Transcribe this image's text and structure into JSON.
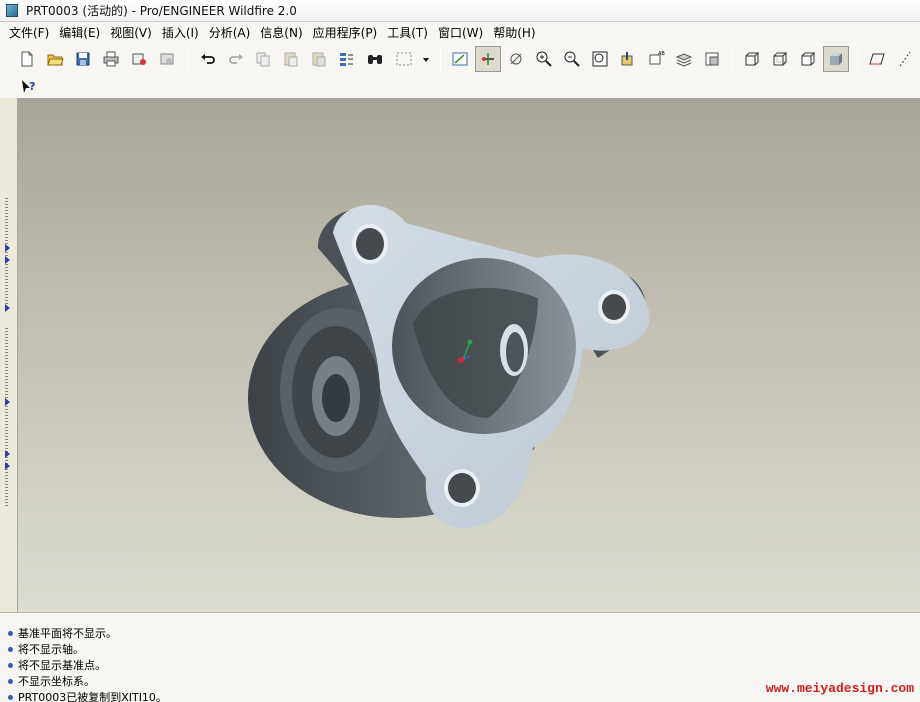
{
  "window": {
    "title": "PRT0003 (活动的) - Pro/ENGINEER Wildfire 2.0"
  },
  "menu": [
    "文件(F)",
    "编辑(E)",
    "视图(V)",
    "插入(I)",
    "分析(A)",
    "信息(N)",
    "应用程序(P)",
    "工具(T)",
    "窗口(W)",
    "帮助(H)"
  ],
  "toolbar": {
    "icons": [
      "new-icon",
      "open-icon",
      "save-icon",
      "print-icon",
      "send-icon",
      "close-window-icon",
      "undo-icon",
      "redo-icon",
      "copy-icon",
      "paste-icon",
      "paste-special-icon",
      "regenerate-icon",
      "find-icon",
      "selection-box-icon",
      "dropdown-icon",
      "datum-plane-icon",
      "datum-axis-icon",
      "datum-point-icon",
      "zoom-in-icon",
      "zoom-out-icon",
      "refit-icon",
      "reorient-icon",
      "saved-views-icon",
      "layers-icon",
      "view-manager-icon",
      "wireframe-icon",
      "hidden-line-icon",
      "no-hidden-icon",
      "shading-icon",
      "datum-plane-display-icon",
      "datum-axis-display-icon"
    ]
  },
  "context_help": "context-help-icon",
  "messages": [
    "基准平面将不显示。",
    "将不显示轴。",
    "将不显示基准点。",
    "不显示坐标系。",
    "PRT0003已被复制到XITI10。"
  ],
  "watermark": "www.meiyadesign.com",
  "colors": {
    "accent_blue": "#2a3ea8",
    "part_face": "#c9d4dd",
    "part_shadow": "#4d5357",
    "watermark": "#d21f1f"
  }
}
